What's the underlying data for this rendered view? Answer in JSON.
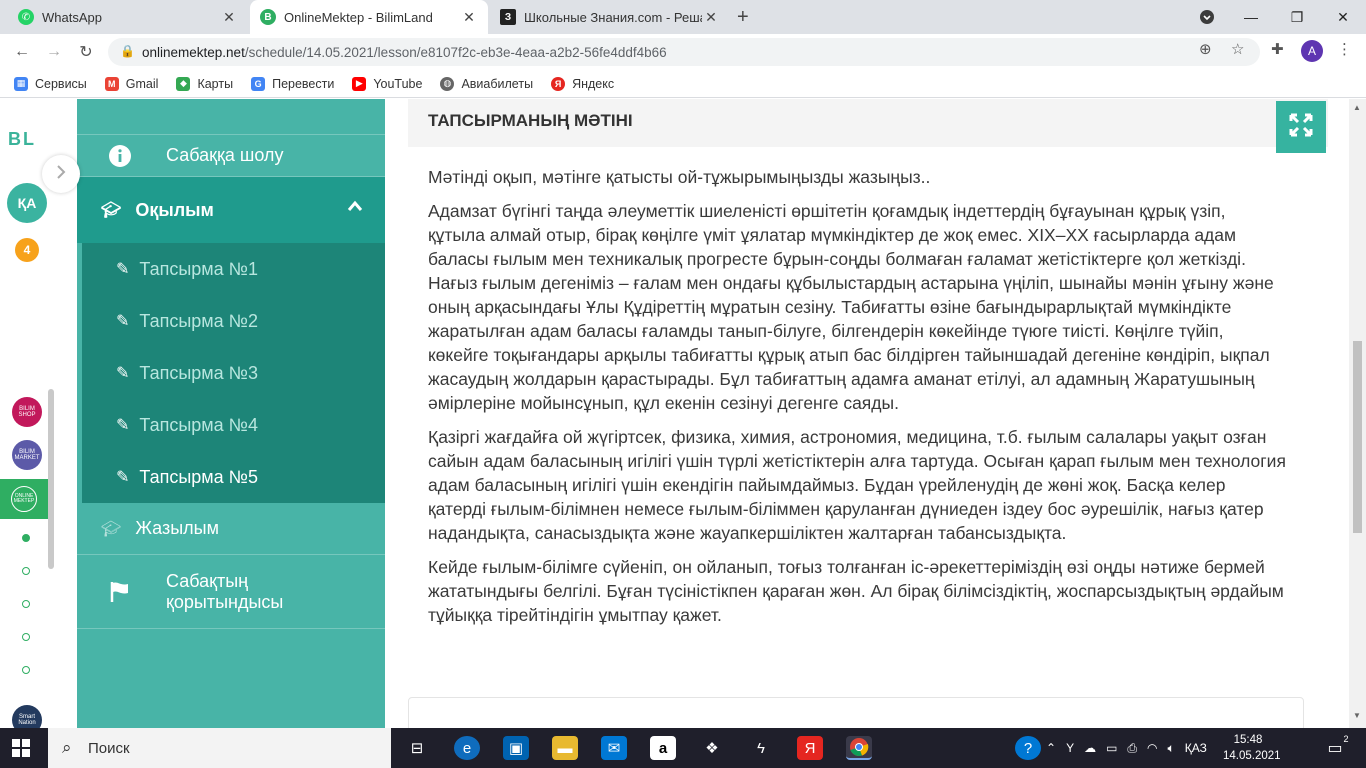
{
  "browser": {
    "tabs": [
      {
        "title": "WhatsApp",
        "icon": "whatsapp-icon"
      },
      {
        "title": "OnlineMektep - BilimLand",
        "icon": "bilimland-icon"
      },
      {
        "title": "Школьные Знания.com - Решае",
        "icon": "znanija-icon"
      }
    ],
    "url_host": "onlinemektep.net",
    "url_path": "/schedule/14.05.2021/lesson/e8107f2c-eb3e-4eaa-a2b2-56fe4ddf4b66",
    "profile_initial": "A",
    "bookmarks": [
      "Сервисы",
      "Gmail",
      "Карты",
      "Перевести",
      "YouTube",
      "Авиабилеты",
      "Яндекс"
    ]
  },
  "rail": {
    "logo": "BL",
    "lang": "ҚА",
    "badge": "4",
    "apps": [
      "BILIM SHOP",
      "BILIM MARKET",
      "ONLINE MEKTEP",
      "Smart Nation"
    ]
  },
  "sidebar": {
    "overview": "Сабаққа шолу",
    "reading": "Оқылым",
    "tasks": [
      "Тапсырма №1",
      "Тапсырма №2",
      "Тапсырма №3",
      "Тапсырма №4",
      "Тапсырма №5"
    ],
    "writing": "Жазылым",
    "summary": "Сабақтың қорытындысы"
  },
  "main": {
    "header": "ТАПСЫРМАНЫҢ МӘТІНІ",
    "paragraphs": [
      "Мәтінді оқып, мәтінге қатысты ой-тұжырымыңызды жазыңыз..",
      "Адамзат бүгінгі таңда әлеуметтік шиеленісті өршітетін қоғамдық індеттердің бұғауынан құрық үзіп, құтыла алмай отыр, бірақ көңілге үміт ұялатар мүмкіндіктер де жоқ емес. XIX–XX ғасырларда адам баласы ғылым мен техникалық прогресте бұрын-соңды болмаған ғаламат жетістіктерге қол жеткізді. Нағыз ғылым дегеніміз – ғалам мен ондағы құбылыстардың астарына үңіліп, шынайы мәнін ұғыну және оның арқасындағы Ұлы Құдіреттің мұратын сезіну. Табиғатты өзіне бағындырарлықтай мүмкіндікте жаратылған адам баласы ғаламды танып-білуге, білгендерін көкейінде түюге тиісті. Көңілге түйіп, көкейге тоқығандары арқылы табиғатты құрық атып бас білдірген тайыншадай дегеніне көндіріп, ықпал жасаудың жолдарын қарастырады. Бұл табиғаттың адамға аманат етілуі, ал адамның Жаратушының әмірлеріне мойынсұнып, құл екенін сезінуі дегенге саяды.",
      "Қазіргі жағдайға ой жүгіртсек, физика, химия, астрономия, медицина, т.б. ғылым салалары уақыт озған сайын адам баласының игілігі үшін түрлі жетістіктерін алға тартуда. Осыған қарап ғылым мен технология адам баласының игілігі үшін екендігін пайымдаймыз. Бұдан үрейленудің де жөні жоқ. Басқа келер қатерді ғылым-білімнен немесе ғылым-біліммен қаруланған дүниеден іздеу бос әурешілік, нағыз қатер надандықта, санасыздықта және жауапкершіліктен жалтарған табансыздықта.",
      "Кейде ғылым-білімге сүйеніп, он ойланып, тоғыз толғанған іс-әрекеттеріміздің өзі оңды нәтиже бермей жататындығы белгілі. Бұған түсіністікпен қараған жөн. Ал бірақ білімсіздіктің, жоспарсыздықтың әрдайым тұйыққа тірейтіндігін ұмытпау қажет."
    ]
  },
  "taskbar": {
    "search_placeholder": "Поиск",
    "lang": "ҚАЗ",
    "time": "15:48",
    "date": "14.05.2021",
    "notifications": "2"
  },
  "colors": {
    "sidebar": "#48b4a7",
    "sidebar_active": "#1f9b8d",
    "sidebar_sub": "#1d8578",
    "accent": "#36b3a0"
  }
}
